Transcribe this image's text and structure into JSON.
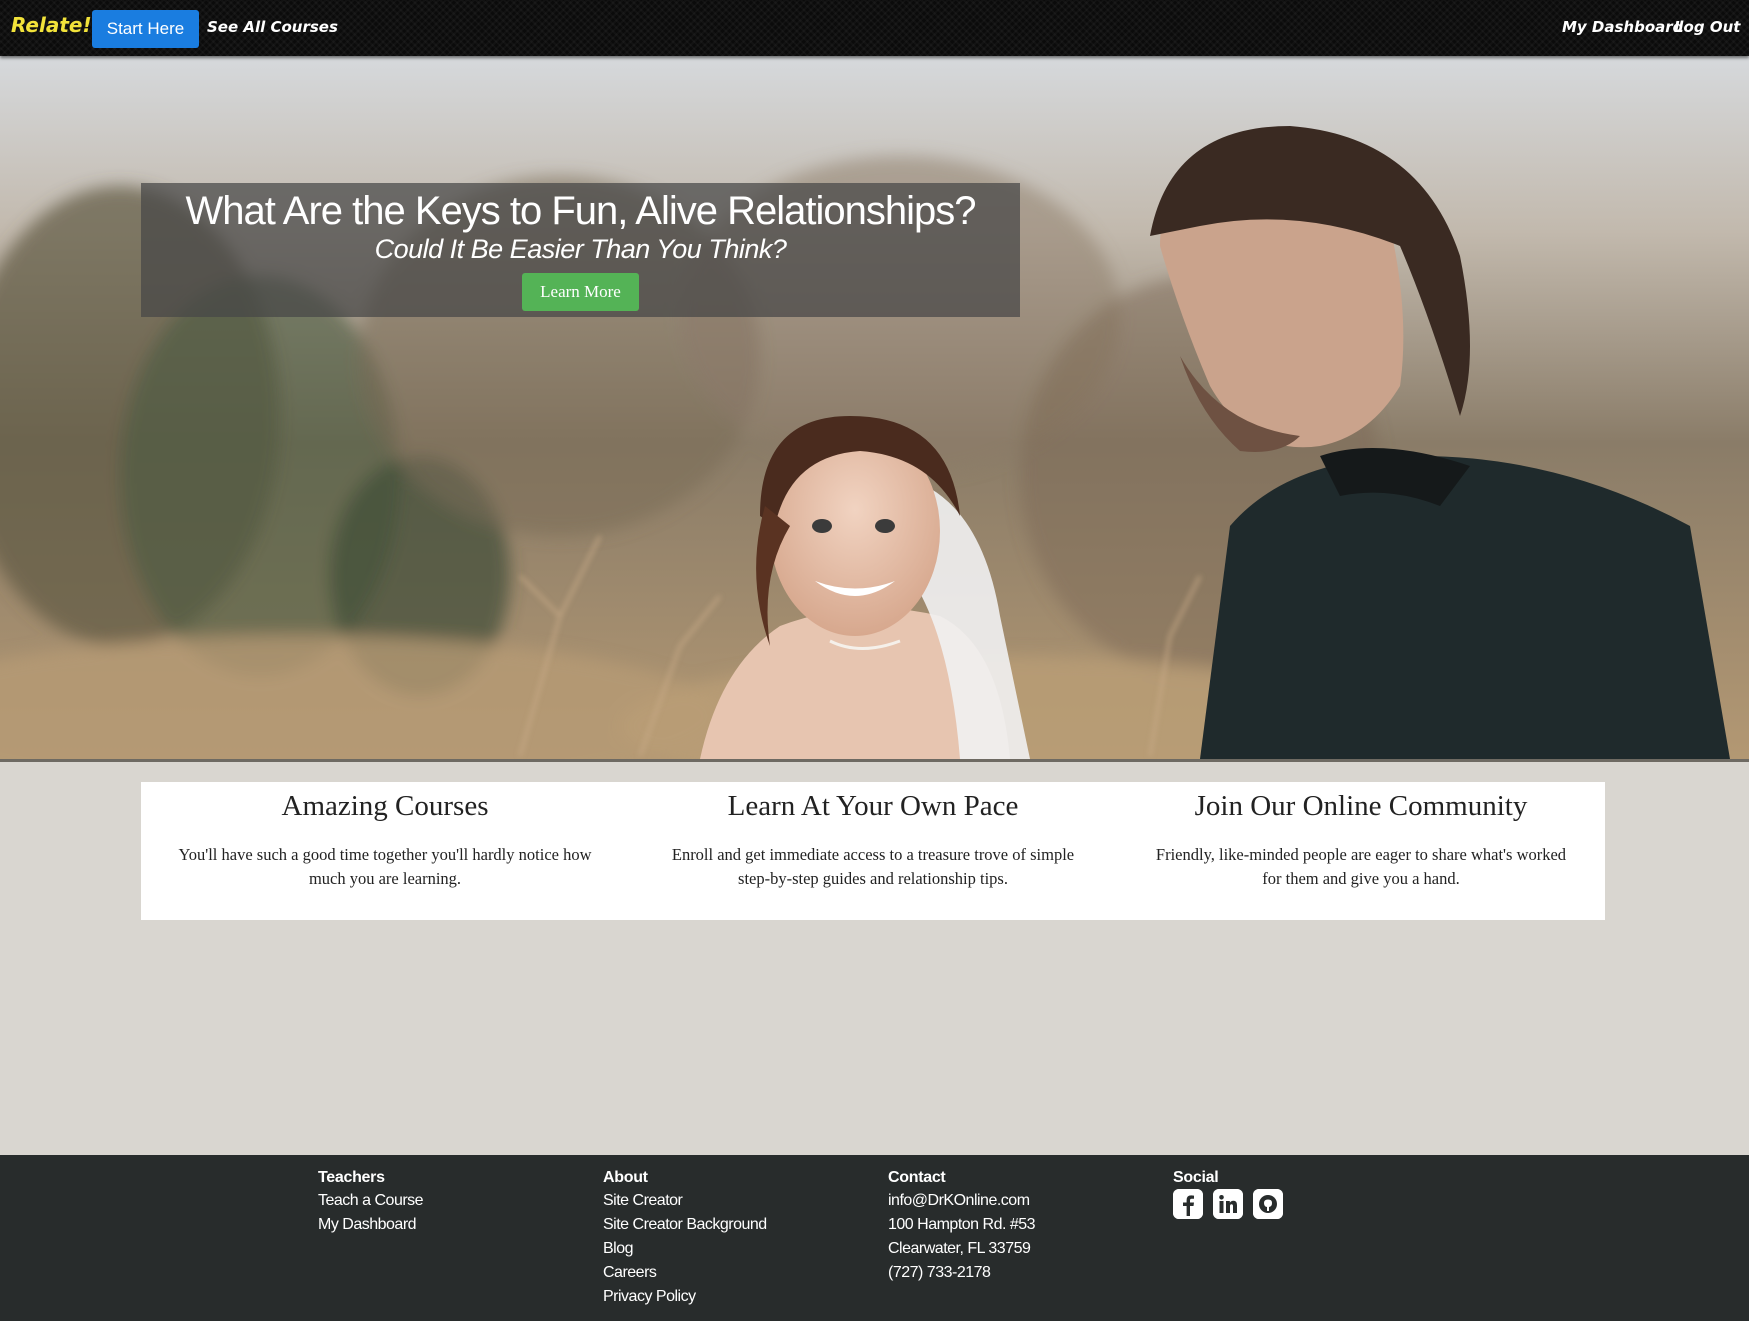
{
  "navbar": {
    "brand": "Relate!",
    "start_button": "Start Here",
    "courses_link": "See All Courses",
    "dashboard_link": "My Dashboard",
    "logout_link": "Log Out"
  },
  "hero": {
    "title": "What Are the Keys to Fun, Alive Relationships?",
    "subtitle": "Could It Be Easier Than You Think?",
    "button": "Learn More"
  },
  "features": [
    {
      "title": "Amazing Courses",
      "text": "You'll have such a good time together you'll hardly notice how much you are learning."
    },
    {
      "title": "Learn At Your Own Pace",
      "text": "Enroll and get immediate access to a treasure trove of simple step-by-step guides and relationship tips."
    },
    {
      "title": "Join Our Online Community",
      "text": "Friendly, like-minded people are eager to share what's worked for them and give you a hand."
    }
  ],
  "footer": {
    "teachers": {
      "heading": "Teachers",
      "links": [
        "Teach a Course",
        "My Dashboard"
      ]
    },
    "about": {
      "heading": "About",
      "links": [
        "Site Creator",
        "Site Creator Background",
        "Blog",
        "Careers",
        "Privacy Policy"
      ]
    },
    "contact": {
      "heading": "Contact",
      "lines": [
        "info@DrKOnline.com",
        "100 Hampton Rd. #53",
        "Clearwater, FL 33759",
        "(727) 733-2178"
      ]
    },
    "social": {
      "heading": "Social",
      "icons": [
        "facebook-icon",
        "linkedin-icon",
        "github-icon"
      ]
    }
  },
  "colors": {
    "brand": "#f2e33a",
    "primary_button": "#1a7de0",
    "success_button": "#54b356",
    "footer_bg": "#282c2c"
  }
}
